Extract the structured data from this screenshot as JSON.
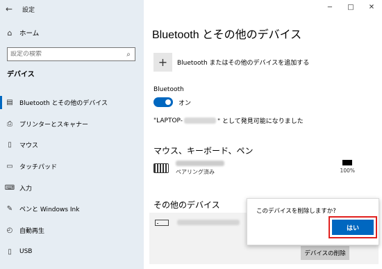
{
  "window": {
    "title": "設定",
    "controls": {
      "minimize": "−",
      "maximize": "□",
      "close": "✕"
    }
  },
  "sidebar": {
    "home_label": "ホーム",
    "search_placeholder": "設定の検索",
    "section_label": "デバイス",
    "items": [
      {
        "icon": "bluetooth-devices-icon",
        "label": "Bluetooth とその他のデバイス",
        "active": true
      },
      {
        "icon": "printer-icon",
        "label": "プリンターとスキャナー"
      },
      {
        "icon": "mouse-icon",
        "label": "マウス"
      },
      {
        "icon": "touchpad-icon",
        "label": "タッチパッド"
      },
      {
        "icon": "keyboard-icon",
        "label": "入力"
      },
      {
        "icon": "pen-icon",
        "label": "ペンと Windows Ink"
      },
      {
        "icon": "autoplay-icon",
        "label": "自動再生"
      },
      {
        "icon": "usb-icon",
        "label": "USB"
      }
    ]
  },
  "main": {
    "title": "Bluetooth とその他のデバイス",
    "add_device_label": "Bluetooth またはその他のデバイスを追加する",
    "bluetooth_label": "Bluetooth",
    "bluetooth_state": "オン",
    "discover_prefix": "\"LAPTOP-",
    "discover_suffix": "\" として発見可能になりました",
    "mouse_section": "マウス、キーボード、ペン",
    "paired_status": "ペアリング済み",
    "battery": "100%",
    "other_section": "その他のデバイス",
    "remove_button": "デバイスの削除"
  },
  "popup": {
    "question": "このデバイスを削除しますか?",
    "yes_button": "はい"
  },
  "colors": {
    "accent": "#0067c0",
    "highlight": "#e0201e",
    "sidebar_bg": "#e6edf3"
  }
}
